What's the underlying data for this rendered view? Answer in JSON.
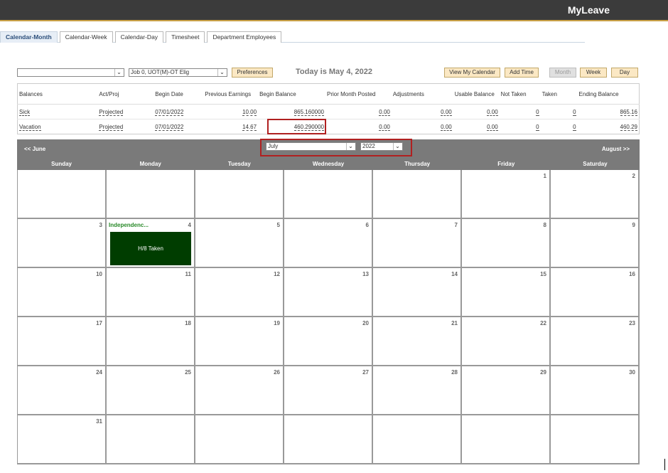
{
  "app": {
    "title": "MyLeave"
  },
  "tabs": [
    {
      "label": "Calendar-Month",
      "active": true
    },
    {
      "label": "Calendar-Week"
    },
    {
      "label": "Calendar-Day"
    },
    {
      "label": "Timesheet"
    },
    {
      "label": "Department Employees"
    }
  ],
  "toolbar": {
    "job_select_value": "Job 0, UOT(M)-OT Elig",
    "preferences_label": "Preferences",
    "today_text": "Today is May 4, 2022",
    "view_calendar_label": "View My Calendar",
    "add_time_label": "Add Time",
    "month_label": "Month",
    "week_label": "Week",
    "day_label": "Day"
  },
  "balances": {
    "headers": [
      "Balances",
      "Act/Proj",
      "Begin Date",
      "Previous Earnings",
      "Begin Balance",
      "Prior Month Posted",
      "Adjustments",
      "Usable Balance",
      "Not Taken",
      "Taken",
      "Ending Balance"
    ],
    "rows": [
      [
        "Sick",
        "Projected",
        "07/01/2022",
        "10.00",
        "865.160000",
        "0.00",
        "0.00",
        "0.00",
        "0",
        "0",
        "865.16"
      ],
      [
        "Vacation",
        "Projected",
        "07/01/2022",
        "14.67",
        "460.290000",
        "0.00",
        "0.00",
        "0.00",
        "0",
        "0",
        "460.29"
      ]
    ]
  },
  "calendar": {
    "prev_label": "<< June",
    "next_label": "August >>",
    "month_value": "July",
    "year_value": "2022",
    "weekdays": [
      "Sunday",
      "Monday",
      "Tuesday",
      "Wednesday",
      "Thursday",
      "Friday",
      "Saturday"
    ],
    "days": [
      "",
      "",
      "",
      "",
      "",
      "1",
      "2",
      "3",
      "4",
      "5",
      "6",
      "7",
      "8",
      "9",
      "10",
      "11",
      "12",
      "13",
      "14",
      "15",
      "16",
      "17",
      "18",
      "19",
      "20",
      "21",
      "22",
      "23",
      "24",
      "25",
      "26",
      "27",
      "28",
      "29",
      "30",
      "31",
      "",
      "",
      "",
      "",
      "",
      ""
    ],
    "holiday_label": "Independenc...",
    "event_label": "H/8 Taken"
  },
  "colors": {
    "header_bg": "#3b3b3b",
    "accent": "#c9a046",
    "calendar_bar": "#7a7a7a",
    "event_bg": "#003d00",
    "holiday_text": "#2a8a2a",
    "highlight": "#b02020"
  }
}
